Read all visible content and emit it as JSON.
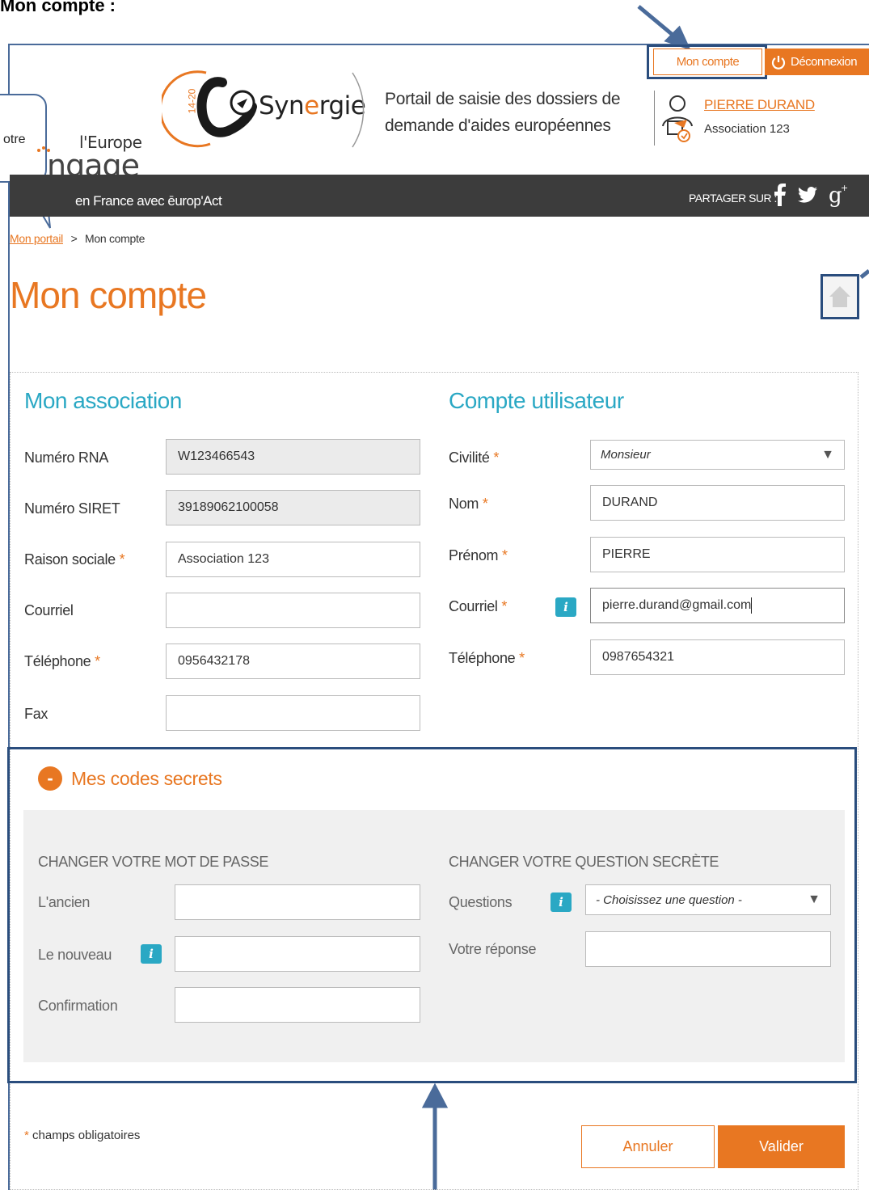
{
  "caption": {
    "text": "Mon compte :"
  },
  "callout": {
    "text": "otre"
  },
  "header": {
    "account_button": "Mon compte",
    "logout_button": "Déconnexion",
    "logo_synergie_left": "Syn",
    "logo_synergie_o": "e",
    "logo_synergie_right": "rgie",
    "logo_badge": "14-20",
    "portal_title_line1": "Portail de saisie des dossiers de",
    "portal_title_line2": "demande d'aides européennes",
    "user_name": "PIERRE DURAND",
    "user_org": "Association 123",
    "europe_line1": "l'Europe",
    "europe_line2": "ngage",
    "nav_subtitle": "en France avec ēurop'Act",
    "share_label": "PARTAGER SUR :"
  },
  "breadcrumb": {
    "home": "Mon portail",
    "sep": ">",
    "current": "Mon compte"
  },
  "page": {
    "title": "Mon compte"
  },
  "association": {
    "title": "Mon association",
    "fields": [
      {
        "label": "Numéro RNA",
        "required": "",
        "value": "W123466543"
      },
      {
        "label": "Numéro SIRET",
        "required": "",
        "value": "39189062100058"
      },
      {
        "label": "Raison sociale",
        "required": "*",
        "value": "Association 123"
      },
      {
        "label": "Courriel",
        "required": "",
        "value": ""
      },
      {
        "label": "Téléphone",
        "required": "*",
        "value": "0956432178"
      },
      {
        "label": "Fax",
        "required": "",
        "value": ""
      }
    ]
  },
  "user_account": {
    "title": "Compte utilisateur",
    "fields": [
      {
        "label": "Civilité",
        "required": "*",
        "value": "Monsieur"
      },
      {
        "label": "Nom",
        "required": "*",
        "value": "DURAND"
      },
      {
        "label": "Prénom",
        "required": "*",
        "value": "PIERRE"
      },
      {
        "label": "Courriel",
        "required": "*",
        "value": "pierre.durand@gmail.com"
      },
      {
        "label": "Téléphone",
        "required": "*",
        "value": "0987654321"
      }
    ]
  },
  "secret_codes": {
    "toggle": "-",
    "title": "Mes codes secrets",
    "password": {
      "heading": "CHANGER VOTRE MOT DE PASSE",
      "old_label": "L'ancien",
      "new_label": "Le nouveau",
      "confirm_label": "Confirmation"
    },
    "question": {
      "heading": "CHANGER VOTRE QUESTION SECRÈTE",
      "questions_label": "Questions",
      "questions_placeholder": "- Choisissez une question -",
      "answer_label": "Votre réponse"
    }
  },
  "info_icon": "i",
  "footer": {
    "required_star": "*",
    "required_note": "champs obligatoires",
    "cancel": "Annuler",
    "submit": "Valider"
  },
  "colors": {
    "accent": "#e87722",
    "teal": "#2aa8c4",
    "navy": "#2a4d7d",
    "dark_bar": "#3c3c3c"
  }
}
